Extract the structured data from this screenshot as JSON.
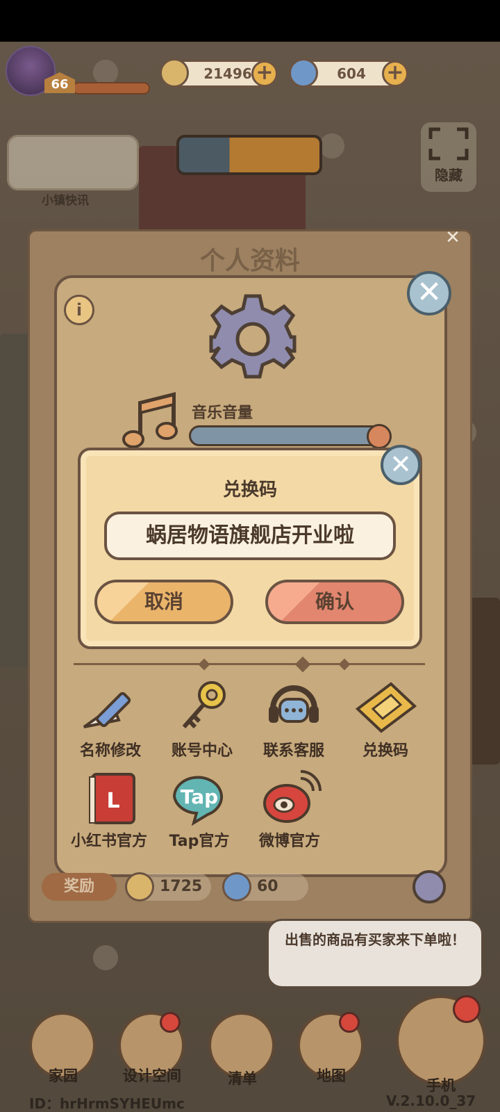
{
  "hud": {
    "level": "66",
    "gold": "21496",
    "swirl": "604",
    "plus": "+",
    "news_label": "小镇快讯",
    "hide_label": "隐藏"
  },
  "profile": {
    "title": "个人资料",
    "info": "i",
    "close": "✕",
    "music_label": "音乐音量",
    "music_volume": 0.92,
    "grid": [
      {
        "label": "名称修改",
        "icon": "pencil-icon"
      },
      {
        "label": "账号中心",
        "icon": "key-icon"
      },
      {
        "label": "联系客服",
        "icon": "headset-icon"
      },
      {
        "label": "兑换码",
        "icon": "ticket-icon"
      },
      {
        "label": "小红书官方",
        "icon": "xiaohongshu-icon"
      },
      {
        "label": "Tap官方",
        "icon": "tap-icon"
      },
      {
        "label": "微博官方",
        "icon": "weibo-icon"
      }
    ],
    "reward_label": "奖励",
    "reward_gold": "1725",
    "reward_swirl": "60"
  },
  "redeem": {
    "title": "兑换码",
    "code_value": "蜗居物语旗舰店开业啦",
    "cancel": "取消",
    "confirm": "确认",
    "close": "✕"
  },
  "notification": "出售的商品有买家来下单啦！",
  "nav": {
    "home": "家园",
    "design": "设计空间",
    "list": "清单",
    "map": "地图",
    "phone": "手机"
  },
  "footer": {
    "id": "ID：hrHrmSYHEUmc",
    "version": "V.2.10.0_37"
  },
  "colors": {
    "panel": "#c7aa7d",
    "dialog": "#f3d9a5",
    "outline": "#6b5342",
    "confirm": "#e2866f",
    "cancel": "#eab46b"
  }
}
